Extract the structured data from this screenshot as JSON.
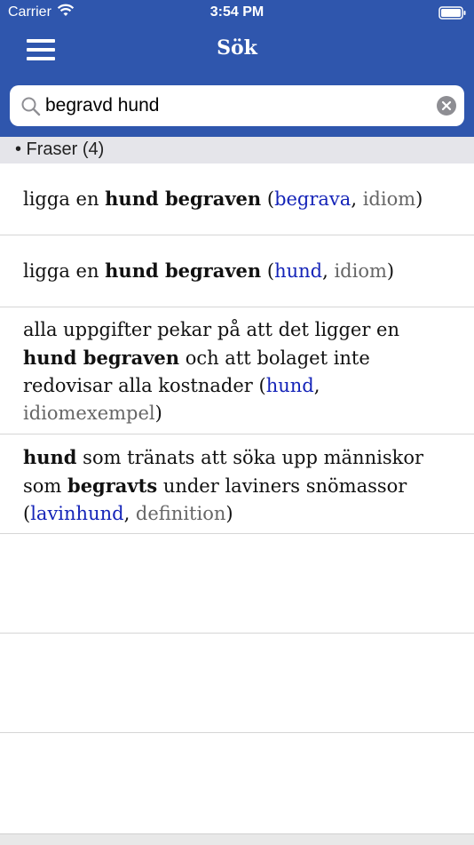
{
  "status": {
    "carrier": "Carrier",
    "time": "3:54 PM"
  },
  "nav": {
    "title": "Sök"
  },
  "search": {
    "value": "begravd hund",
    "placeholder": ""
  },
  "section": {
    "label": "• Fraser (4)"
  },
  "results": [
    {
      "pre": "ligga en ",
      "bold1": "hund begraven",
      "mid": " (",
      "link": "begrava",
      "sep": ", ",
      "kind": "idiom",
      "post": ")"
    },
    {
      "pre": "ligga en ",
      "bold1": "hund begraven",
      "mid": " (",
      "link": "hund",
      "sep": ", ",
      "kind": "idiom",
      "post": ")"
    },
    {
      "pre": "alla uppgifter pekar på att det ligger en ",
      "bold1": "hund begraven",
      "mid": " och att bolaget inte redovisar alla kostnader (",
      "link": "hund",
      "sep": ", ",
      "kind": "idiomexempel",
      "post": ")"
    },
    {
      "bold0": "hund",
      "pre": " som tränats att söka upp människor som ",
      "bold1": "begravts",
      "mid": " under laviners snömassor (",
      "link": "lavinhund",
      "sep": ", ",
      "kind": "definition",
      "post": ")"
    }
  ]
}
